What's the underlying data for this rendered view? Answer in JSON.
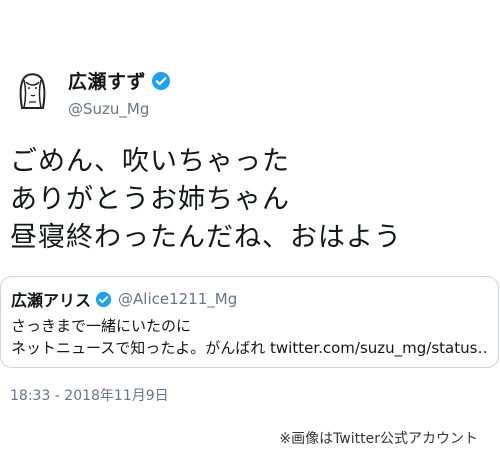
{
  "author": {
    "display_name": "広瀬すず",
    "handle": "@Suzu_Mg",
    "verified": true,
    "avatar_icon": "avatar-sketch-icon"
  },
  "tweet": {
    "lines": [
      "ごめん、吹いちゃった",
      "ありがとうお姉ちゃん",
      "昼寝終わったんだね、おはよう"
    ]
  },
  "quoted_tweet": {
    "display_name": "広瀬アリス",
    "handle": "@Alice1211_Mg",
    "verified": true,
    "lines": [
      "さっきまで一緒にいたのに",
      "ネットニュースで知ったよ。がんばれ twitter.com/suzu_mg/status…"
    ]
  },
  "timestamp": "18:33 - 2018年11月9日",
  "credit": "※画像はTwitter公式アカウント",
  "colors": {
    "verified_blue": "#1da1f2",
    "secondary_text": "#657786",
    "border": "#ccd6dd"
  }
}
